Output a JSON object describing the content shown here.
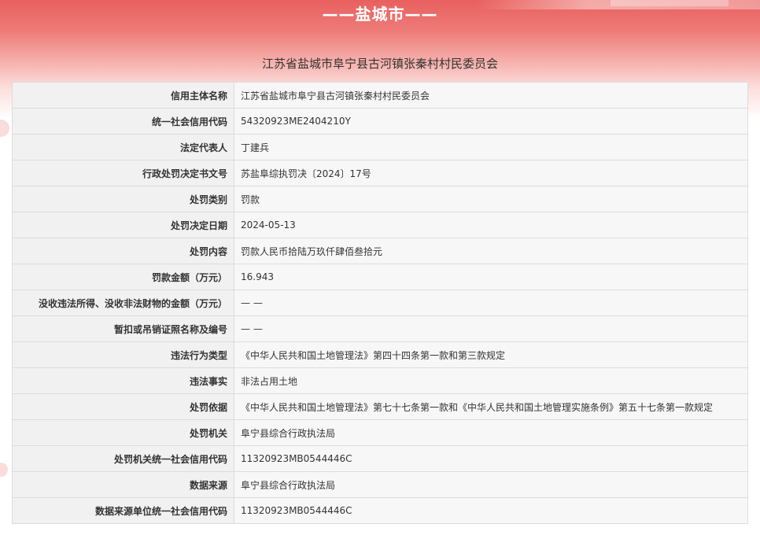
{
  "header": {
    "city_title": "——盐城市——",
    "org_title": "江苏省盐城市阜宁县古河镇张秦村村民委员会"
  },
  "rows": [
    {
      "label": "信用主体名称",
      "value": "江苏省盐城市阜宁县古河镇张秦村村民委员会"
    },
    {
      "label": "统一社会信用代码",
      "value": "54320923ME2404210Y"
    },
    {
      "label": "法定代表人",
      "value": "丁建兵"
    },
    {
      "label": "行政处罚决定书文号",
      "value": "苏盐阜综执罚决〔2024〕17号"
    },
    {
      "label": "处罚类别",
      "value": "罚款"
    },
    {
      "label": "处罚决定日期",
      "value": "2024-05-13"
    },
    {
      "label": "处罚内容",
      "value": "罚款人民币拾陆万玖仟肆佰叁拾元"
    },
    {
      "label": "罚款金额（万元）",
      "value": "16.943"
    },
    {
      "label": "没收违法所得、没收非法财物的金额（万元）",
      "value": "— —"
    },
    {
      "label": "暂扣或吊销证照名称及编号",
      "value": "— —"
    },
    {
      "label": "违法行为类型",
      "value": "《中华人民共和国土地管理法》第四十四条第一款和第三款规定"
    },
    {
      "label": "违法事实",
      "value": "非法占用土地"
    },
    {
      "label": "处罚依据",
      "value": "《中华人民共和国土地管理法》第七十七条第一款和《中华人民共和国土地管理实施条例》第五十七条第一款规定"
    },
    {
      "label": "处罚机关",
      "value": "阜宁县综合行政执法局"
    },
    {
      "label": "处罚机关统一社会信用代码",
      "value": "11320923MB0544446C"
    },
    {
      "label": "数据来源",
      "value": "阜宁县综合行政执法局"
    },
    {
      "label": "数据来源单位统一社会信用代码",
      "value": "11320923MB0544446C"
    }
  ],
  "colors": {
    "banner_top": "#e8605f",
    "label_bg": "#f1f1f1",
    "value_bg": "#f7f7f7",
    "border": "#dcdcdc",
    "text": "#333333"
  }
}
